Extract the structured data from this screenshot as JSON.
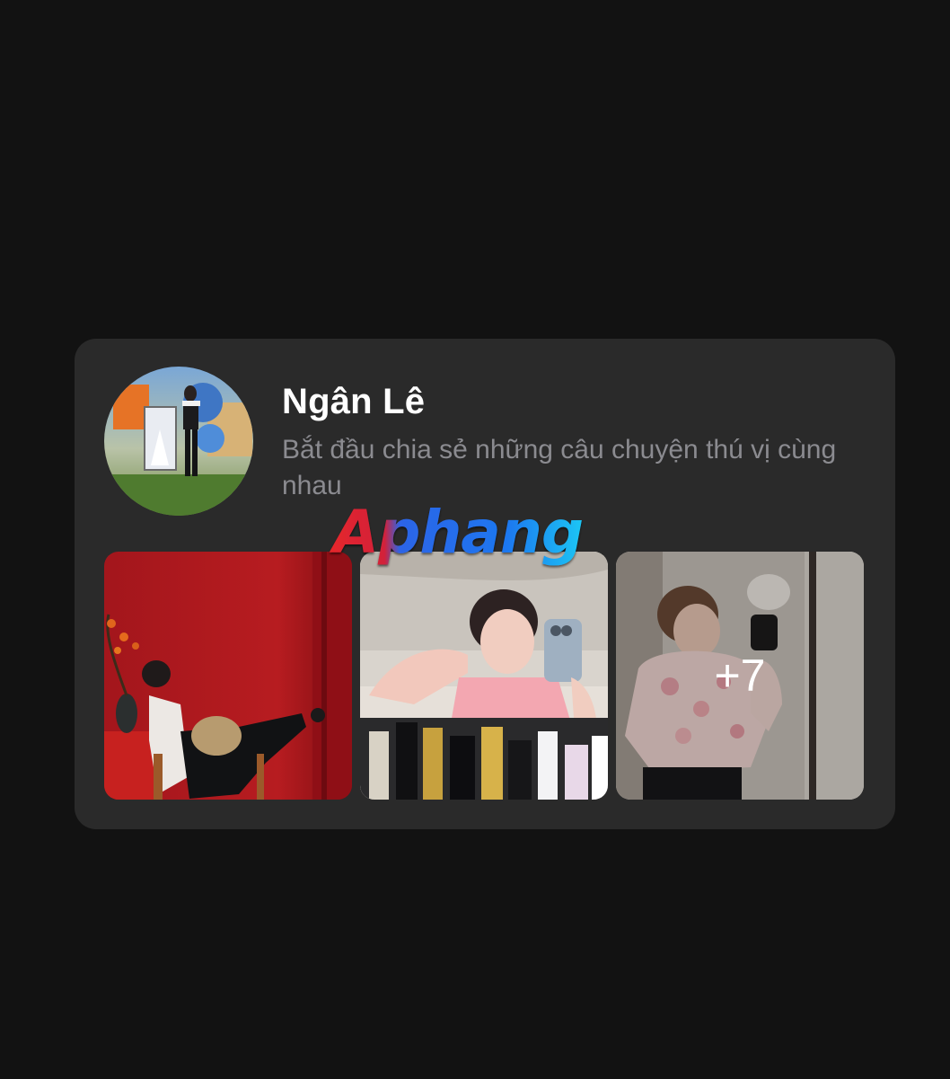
{
  "profile": {
    "name": "Ngân Lê",
    "subtitle": "Bắt đầu chia sẻ những câu chuyện thú vị cùng nhau"
  },
  "watermark": {
    "text": "Aphang"
  },
  "photos": [
    {
      "id": "photo-1",
      "description": "studio-red-background"
    },
    {
      "id": "photo-2",
      "description": "mirror-selfie-pink"
    },
    {
      "id": "photo-3",
      "description": "mirror-selfie-floral"
    }
  ],
  "more_photos": {
    "label": "+7"
  },
  "colors": {
    "page_background": "#121212",
    "card_background": "#2a2a2a",
    "name_text": "#ffffff",
    "subtitle_text": "#8b8b90"
  }
}
